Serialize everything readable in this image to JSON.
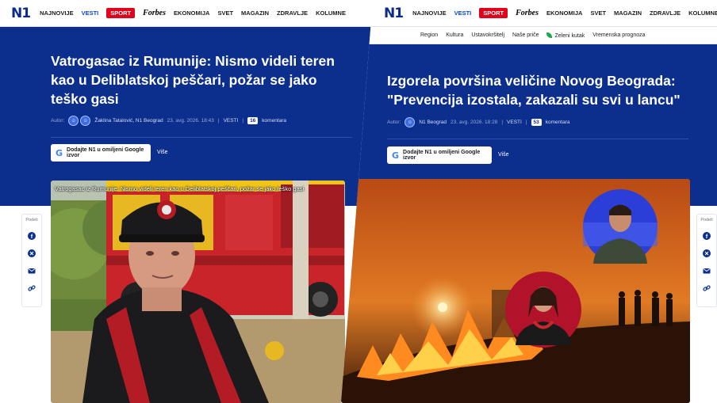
{
  "brand": {
    "logo": "N1"
  },
  "nav": {
    "items": [
      "NAJNOVIJE",
      "VESTI",
      "SPORT",
      "Forbes",
      "EKONOMIJA",
      "SVET",
      "MAGAZIN",
      "ZDRAVLJE",
      "KOLUMNE"
    ],
    "active": "VESTI"
  },
  "subnav": {
    "items": [
      "Region",
      "Kultura",
      "Ustavokršitelj",
      "Naše priče",
      "Zeleni kutak",
      "Vremenska prognoza"
    ]
  },
  "left_article": {
    "headline_lines": [
      "Vatrogasac iz Rumunije: Nismo videli teren",
      "kao u Deliblatskoj peščari, požar se jako",
      "teško gasi"
    ],
    "author_label": "Autor:",
    "author": "Žaklina Tatalović, N1 Beograd",
    "date": "23. avg. 2026. 18:43",
    "category": "VESTI",
    "comment_count": "16",
    "comment_label": "komentara",
    "google_button": "Dodajte N1 u omiljeni Google izvor",
    "more": "Više",
    "photo_caption": "Vatrogasac iz Rumunije: Nismo videli teren kao u Deliblatskoj peščari, požar se jako teško gasi"
  },
  "right_article": {
    "headline_lines": [
      "Izgorela površina veličine Novog Beograda:",
      "\"Prevencija izostala, zakazali su svi u lancu\""
    ],
    "author_label": "Autor:",
    "author": "N1 Beograd",
    "date": "23. avg. 2026. 18:28",
    "category": "VESTI",
    "comment_count": "53",
    "comment_label": "komentara",
    "google_button": "Dodajte N1 u omiljeni Google izvor",
    "more": "Više"
  },
  "share": {
    "label": "Podeli",
    "icons": [
      "facebook-icon",
      "x-icon",
      "mail-icon",
      "link-icon"
    ]
  },
  "colors": {
    "brand_blue": "#0c2f8e",
    "accent_blue": "#0b45d6",
    "sport_red": "#e0001b"
  }
}
